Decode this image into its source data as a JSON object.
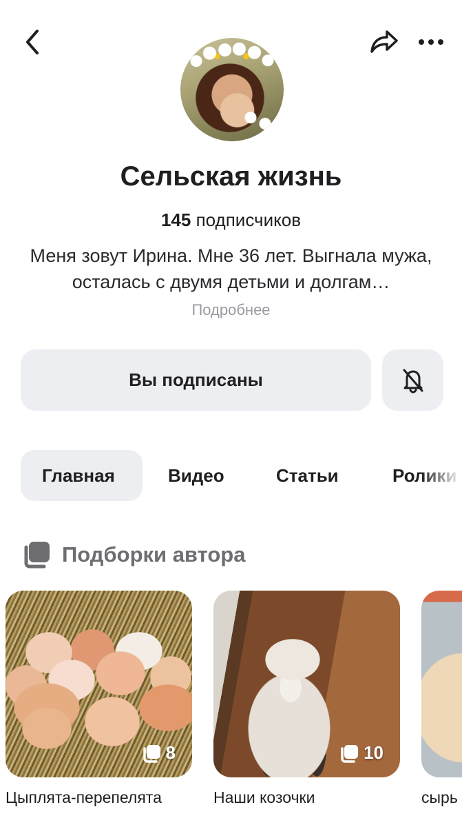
{
  "header": {
    "back_icon": "chevron-left-icon",
    "share_icon": "share-arrow-icon",
    "more_icon": "more-dots-icon"
  },
  "channel": {
    "title": "Сельская жизнь",
    "subscribers_count": "145",
    "subscribers_label": "подписчиков",
    "description": "Меня зовут Ирина. Мне 36 лет. Выгнала мужа, осталась с двумя детьми и долгам…",
    "more_link": "Подробнее"
  },
  "actions": {
    "subscribed_label": "Вы подписаны",
    "bell_icon": "bell-off-icon"
  },
  "tabs": [
    {
      "label": "Главная",
      "active": true
    },
    {
      "label": "Видео",
      "active": false
    },
    {
      "label": "Статьи",
      "active": false
    },
    {
      "label": "Ролики",
      "active": false
    }
  ],
  "collections": {
    "section_title": "Подборки автора",
    "section_icon": "collections-icon",
    "items": [
      {
        "caption": "Цыплята-перепелята",
        "count": "8"
      },
      {
        "caption": "Наши козочки",
        "count": "10"
      },
      {
        "caption": "сырь",
        "count": ""
      }
    ]
  },
  "colors": {
    "button_bg": "#eceef2",
    "text": "#1f1f22",
    "muted": "#9a9aa0",
    "section_title": "#6d6d72"
  }
}
